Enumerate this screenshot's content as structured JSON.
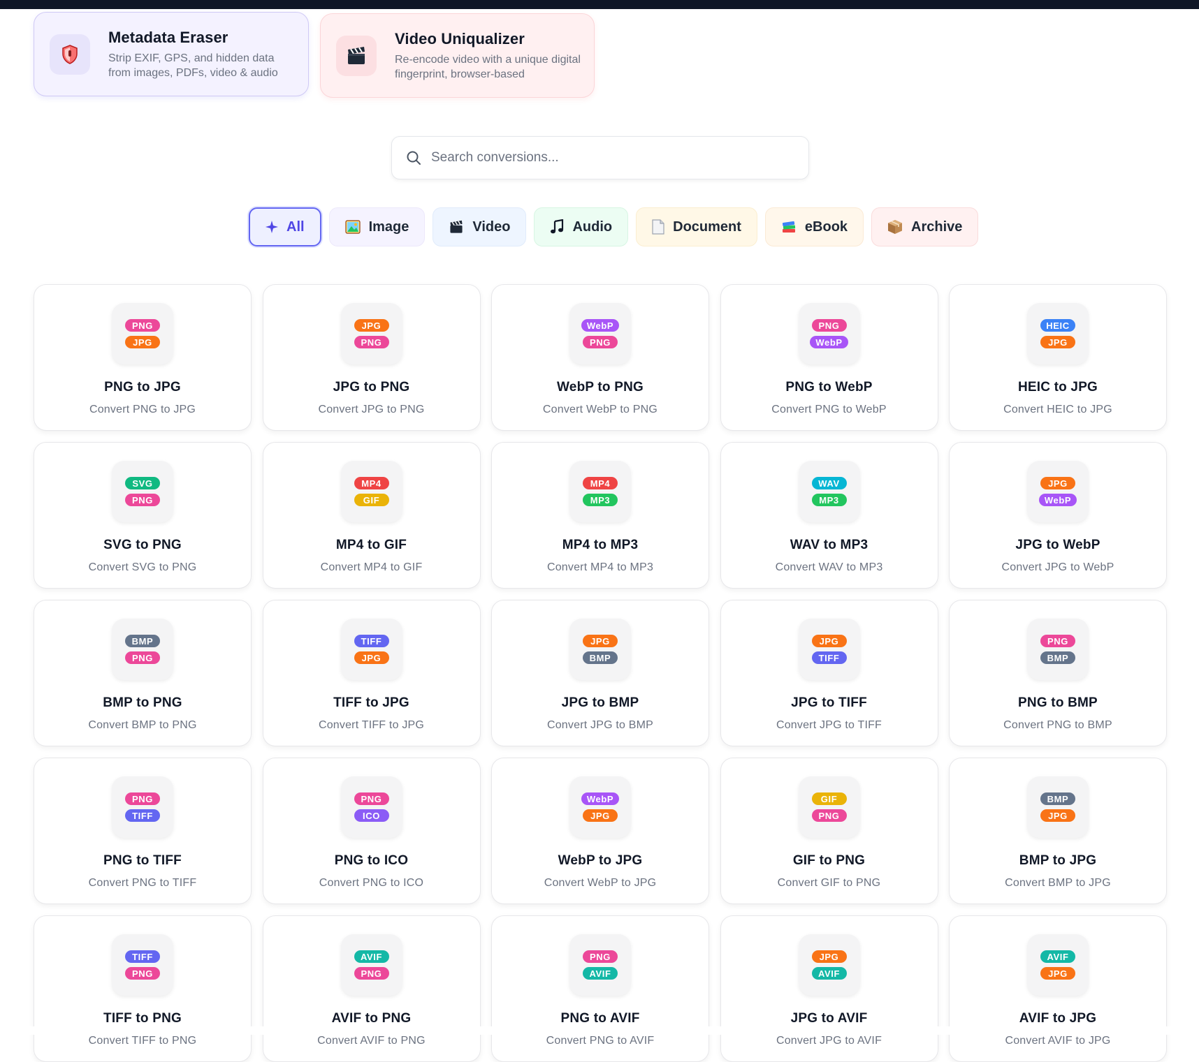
{
  "features": [
    {
      "title": "Metadata Eraser",
      "desc": "Strip EXIF, GPS, and hidden data from images, PDFs, video & audio",
      "icon": "shield-icon"
    },
    {
      "title": "Video Uniqualizer",
      "desc": "Re-encode video with a unique digital fingerprint, browser-based",
      "icon": "clapperboard-icon"
    }
  ],
  "search": {
    "placeholder": "Search conversions..."
  },
  "filters": [
    {
      "label": "All",
      "icon": "sparkle-icon",
      "active": true
    },
    {
      "label": "Image",
      "icon": "picture-icon"
    },
    {
      "label": "Video",
      "icon": "clapperboard-icon"
    },
    {
      "label": "Audio",
      "icon": "music-note-icon"
    },
    {
      "label": "Document",
      "icon": "document-icon"
    },
    {
      "label": "eBook",
      "icon": "books-icon"
    },
    {
      "label": "Archive",
      "icon": "package-icon"
    }
  ],
  "format_colors": {
    "PNG": "#ec4899",
    "JPG": "#f97316",
    "WebP": "#a855f7",
    "HEIC": "#3b82f6",
    "SVG": "#10b981",
    "MP4": "#ef4444",
    "GIF": "#eab308",
    "MP3": "#22c55e",
    "WAV": "#06b6d4",
    "BMP": "#64748b",
    "TIFF": "#6366f1",
    "ICO": "#8b5cf6",
    "AVIF": "#14b8a6"
  },
  "conversions": [
    {
      "from": "PNG",
      "to": "JPG",
      "title": "PNG to JPG",
      "desc": "Convert PNG to JPG"
    },
    {
      "from": "JPG",
      "to": "PNG",
      "title": "JPG to PNG",
      "desc": "Convert JPG to PNG"
    },
    {
      "from": "WebP",
      "to": "PNG",
      "title": "WebP to PNG",
      "desc": "Convert WebP to PNG"
    },
    {
      "from": "PNG",
      "to": "WebP",
      "title": "PNG to WebP",
      "desc": "Convert PNG to WebP"
    },
    {
      "from": "HEIC",
      "to": "JPG",
      "title": "HEIC to JPG",
      "desc": "Convert HEIC to JPG"
    },
    {
      "from": "SVG",
      "to": "PNG",
      "title": "SVG to PNG",
      "desc": "Convert SVG to PNG"
    },
    {
      "from": "MP4",
      "to": "GIF",
      "title": "MP4 to GIF",
      "desc": "Convert MP4 to GIF"
    },
    {
      "from": "MP4",
      "to": "MP3",
      "title": "MP4 to MP3",
      "desc": "Convert MP4 to MP3"
    },
    {
      "from": "WAV",
      "to": "MP3",
      "title": "WAV to MP3",
      "desc": "Convert WAV to MP3"
    },
    {
      "from": "JPG",
      "to": "WebP",
      "title": "JPG to WebP",
      "desc": "Convert JPG to WebP"
    },
    {
      "from": "BMP",
      "to": "PNG",
      "title": "BMP to PNG",
      "desc": "Convert BMP to PNG"
    },
    {
      "from": "TIFF",
      "to": "JPG",
      "title": "TIFF to JPG",
      "desc": "Convert TIFF to JPG"
    },
    {
      "from": "JPG",
      "to": "BMP",
      "title": "JPG to BMP",
      "desc": "Convert JPG to BMP"
    },
    {
      "from": "JPG",
      "to": "TIFF",
      "title": "JPG to TIFF",
      "desc": "Convert JPG to TIFF"
    },
    {
      "from": "PNG",
      "to": "BMP",
      "title": "PNG to BMP",
      "desc": "Convert PNG to BMP"
    },
    {
      "from": "PNG",
      "to": "TIFF",
      "title": "PNG to TIFF",
      "desc": "Convert PNG to TIFF"
    },
    {
      "from": "PNG",
      "to": "ICO",
      "title": "PNG to ICO",
      "desc": "Convert PNG to ICO"
    },
    {
      "from": "WebP",
      "to": "JPG",
      "title": "WebP to JPG",
      "desc": "Convert WebP to JPG"
    },
    {
      "from": "GIF",
      "to": "PNG",
      "title": "GIF to PNG",
      "desc": "Convert GIF to PNG"
    },
    {
      "from": "BMP",
      "to": "JPG",
      "title": "BMP to JPG",
      "desc": "Convert BMP to JPG"
    },
    {
      "from": "TIFF",
      "to": "PNG",
      "title": "TIFF to PNG",
      "desc": "Convert TIFF to PNG"
    },
    {
      "from": "AVIF",
      "to": "PNG",
      "title": "AVIF to PNG",
      "desc": "Convert AVIF to PNG"
    },
    {
      "from": "PNG",
      "to": "AVIF",
      "title": "PNG to AVIF",
      "desc": "Convert PNG to AVIF"
    },
    {
      "from": "JPG",
      "to": "AVIF",
      "title": "JPG to AVIF",
      "desc": "Convert JPG to AVIF"
    },
    {
      "from": "AVIF",
      "to": "JPG",
      "title": "AVIF to JPG",
      "desc": "Convert AVIF to JPG"
    }
  ]
}
